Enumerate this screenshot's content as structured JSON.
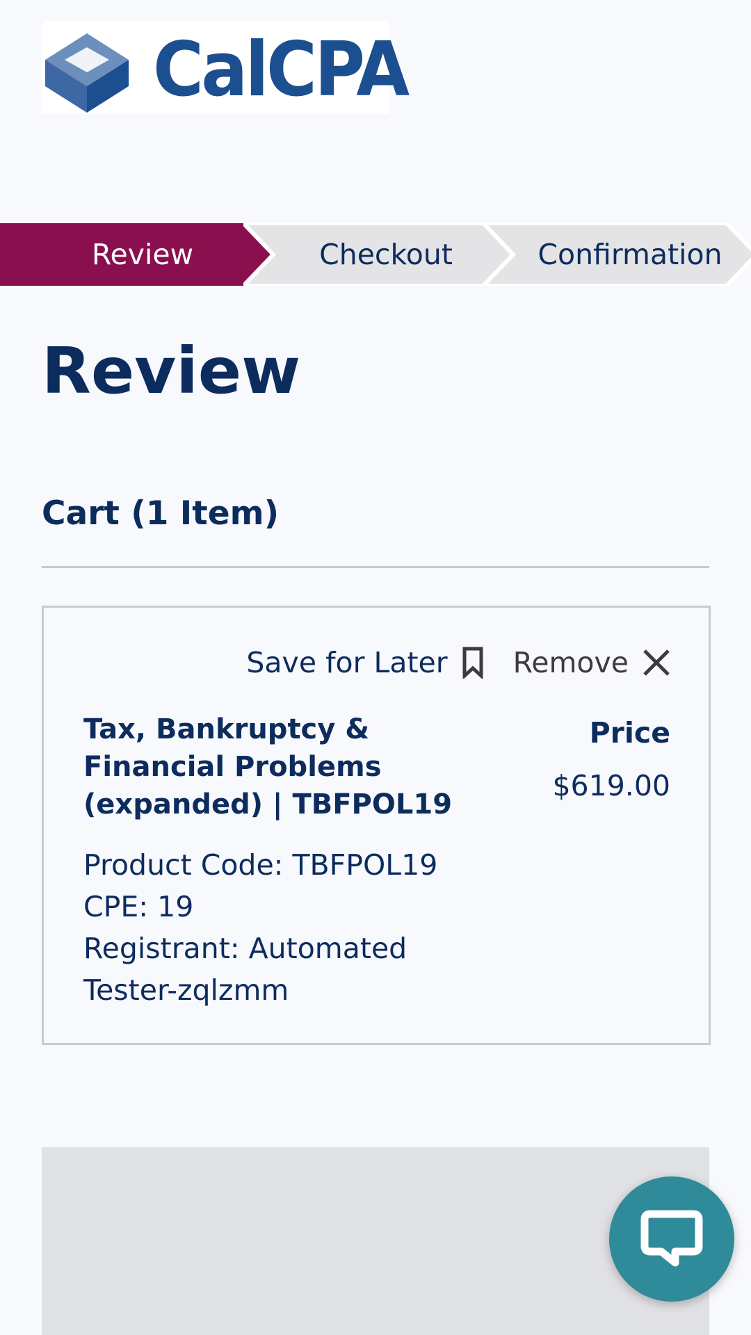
{
  "brand": {
    "logo_text": "CalCPA",
    "primary": "#1b4f8f",
    "accent": "#8a0f4e"
  },
  "steps": [
    {
      "label": "Review",
      "active": true
    },
    {
      "label": "Checkout",
      "active": false
    },
    {
      "label": "Confirmation",
      "active": false
    }
  ],
  "page": {
    "title": "Review"
  },
  "cart": {
    "title": "Cart (1 Item)",
    "save_for_later": "Save for Later",
    "remove": "Remove",
    "item": {
      "title": "Tax, Bankruptcy & Financial Problems (expanded) | TBFPOL19",
      "price_label": "Price",
      "price": "$619.00",
      "product_code": "Product Code: TBFPOL19",
      "cpe": "CPE: 19",
      "registrant": "Registrant: Automated Tester-zqlzmm"
    }
  },
  "icons": {
    "save": "bookmark-icon",
    "remove": "close-icon",
    "chat": "chat-bubble-icon"
  }
}
